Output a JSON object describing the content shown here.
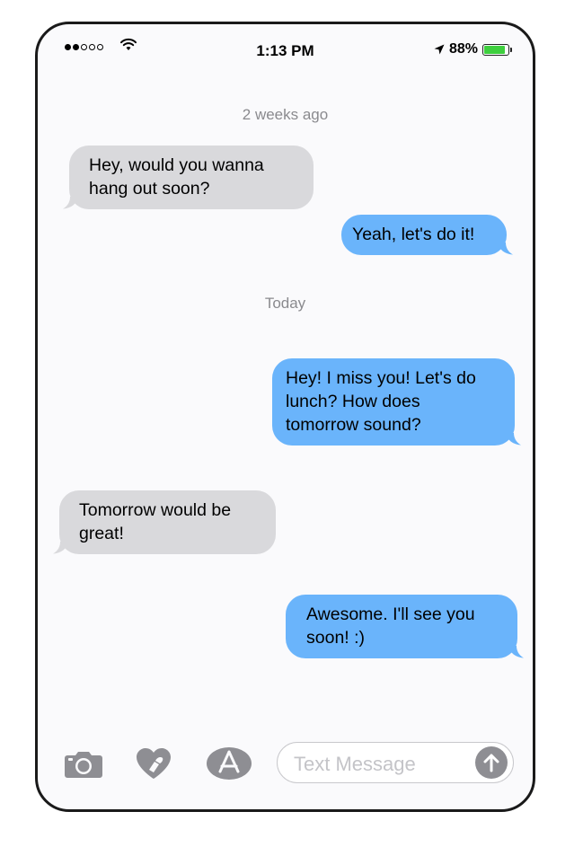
{
  "status_bar": {
    "time": "1:13 PM",
    "battery_percent": "88%",
    "battery_level": 0.88,
    "signal_bars_filled": 2,
    "signal_bars_total": 5
  },
  "conversation": {
    "timestamps": [
      "2 weeks ago",
      "Today"
    ],
    "messages": [
      {
        "direction": "incoming",
        "text_line1": "Hey, would you wanna",
        "text_line2": "hang out soon?"
      },
      {
        "direction": "outgoing",
        "text_line1": "Yeah, let's do it!"
      },
      {
        "direction": "outgoing",
        "text_line1": "Hey! I miss you! Let's do",
        "text_line2": "lunch? How does",
        "text_line3": "tomorrow sound?"
      },
      {
        "direction": "incoming",
        "text_line1": "Tomorrow would be",
        "text_line2": "great!"
      },
      {
        "direction": "outgoing",
        "text_line1": "Awesome. I'll see you",
        "text_line2": "soon! :)"
      }
    ]
  },
  "composer": {
    "placeholder": "Text Message",
    "icons": [
      "camera-icon",
      "digital-touch-icon",
      "app-store-icon",
      "send-arrow-icon"
    ]
  },
  "colors": {
    "incoming_bubble": "#d9d9dc",
    "outgoing_bubble": "#6ab4fb",
    "battery_fill": "#3ecf3e",
    "icon_gray": "#8e8e93"
  }
}
